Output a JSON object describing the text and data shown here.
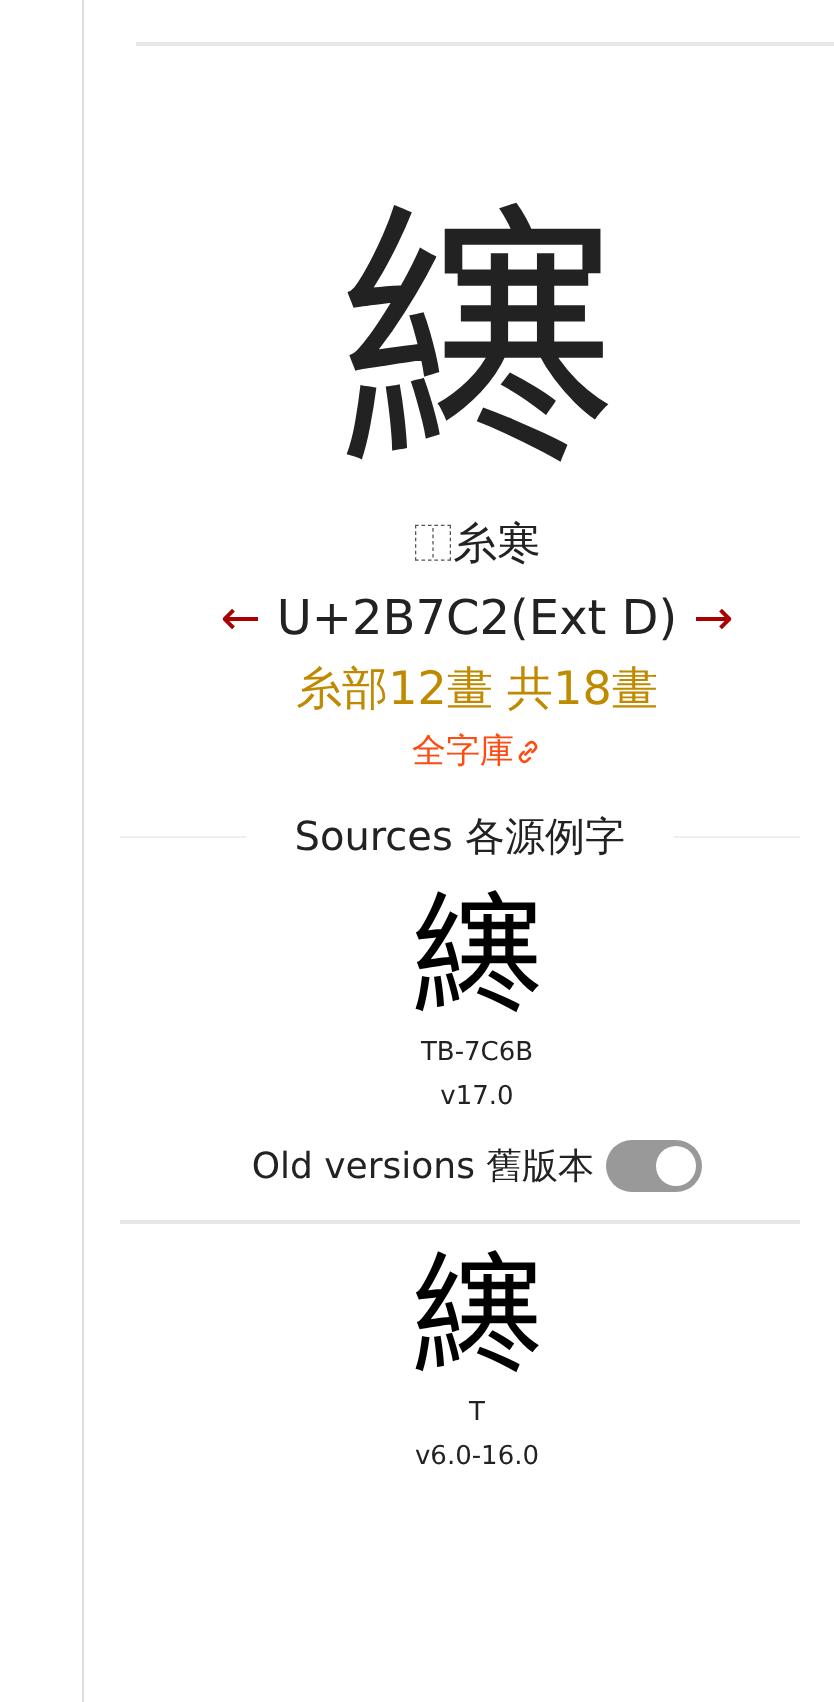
{
  "character": "𫟂",
  "composition": {
    "ids": "⿰",
    "components": "糸寒"
  },
  "codepoint": {
    "prev": "←",
    "label": "U+2B7C2(Ext D)",
    "next": "→"
  },
  "strokes": "糸部12畫 共18畫",
  "link": "全字庫",
  "sources": {
    "heading": "Sources 各源例字",
    "current": [
      {
        "glyph": "𫟂",
        "source": "TB-7C6B",
        "version": "v17.0"
      }
    ],
    "old_versions": {
      "label": "Old versions 舊版本",
      "on": true
    },
    "old": [
      {
        "glyph": "𫟂",
        "source": "T",
        "version": "v6.0-16.0"
      }
    ]
  }
}
